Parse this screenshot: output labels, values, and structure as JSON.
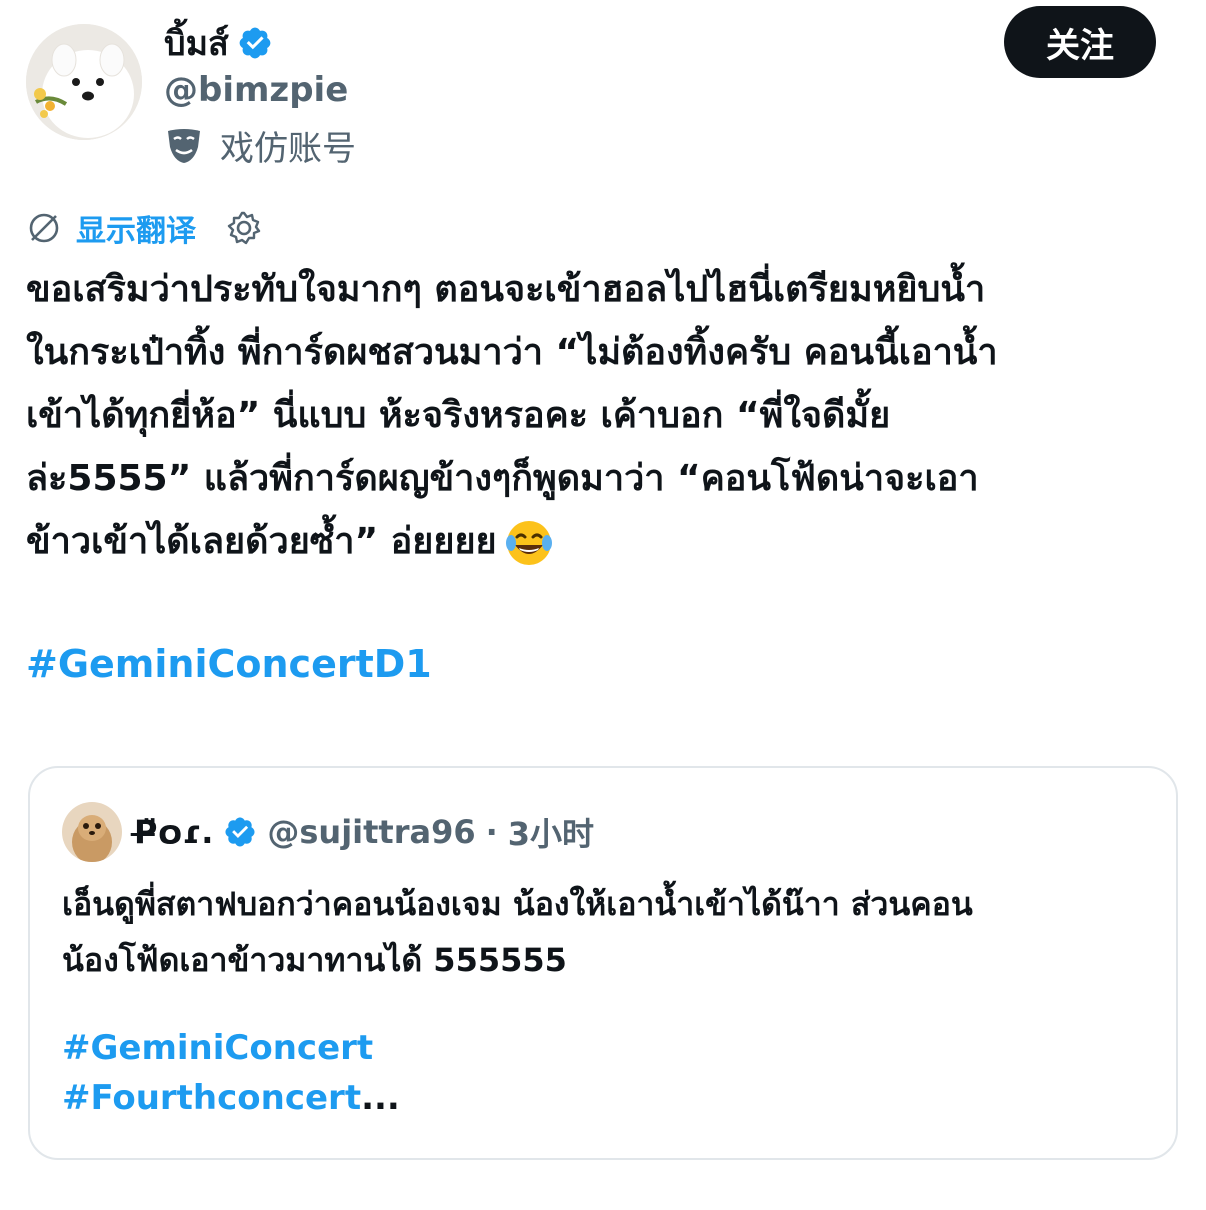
{
  "author": {
    "display_name": "บิ้มส์",
    "handle": "@bimzpie",
    "parody_label": "戏仿账号",
    "verified": true,
    "avatar_icon": "samoyed-avatar"
  },
  "follow_button": {
    "label": "关注"
  },
  "translate": {
    "label": "显示翻译",
    "icon": "translate-icon",
    "settings_icon": "gear-icon"
  },
  "tweet": {
    "lines": [
      "ขอเสริมว่าประทับใจมากๆ ตอนจะเข้าฮอลไปไฮนี่เตรียมหยิบน้ำ",
      "ในกระเป๋าทิ้ง พี่การ์ดผชสวนมาว่า “ไม่ต้องทิ้งครับ คอนนี้เอาน้ำ",
      "เข้าได้ทุกยี่ห้อ” นี่แบบ ห้ะจริงหรอคะ เค้าบอก “พี่ใจดีมั้ย",
      "ล่ะ5555” แล้วพี่การ์ดผญข้างๆก็พูดมาว่า “คอนโฟ้ดน่าจะเอา",
      "ข้าวเข้าได้เลยด้วยซ้ำ” อ่ยยยย"
    ],
    "emoji": "face-with-tears-of-joy",
    "hashtag": "#GeminiConcertD1"
  },
  "quote": {
    "display_name": "P̶̈໐ɾ.",
    "verified": true,
    "handle": "@sujittra96",
    "separator": "·",
    "time": "3小时",
    "lines": [
      "เอ็นดูพี่สตาฟบอกว่าคอนน้องเจม น้องให้เอาน้ำเข้าได้น๊าา ส่วนคอน",
      "น้องโฟ้ดเอาข้าวมาทานได้ 555555"
    ],
    "hashtags": [
      "#GeminiConcert",
      "#Fourthconcert"
    ],
    "ellipsis": "..."
  },
  "colors": {
    "accent": "#1d9bf0",
    "text": "#0f1419",
    "muted": "#536471",
    "border": "#e1e6ea"
  }
}
